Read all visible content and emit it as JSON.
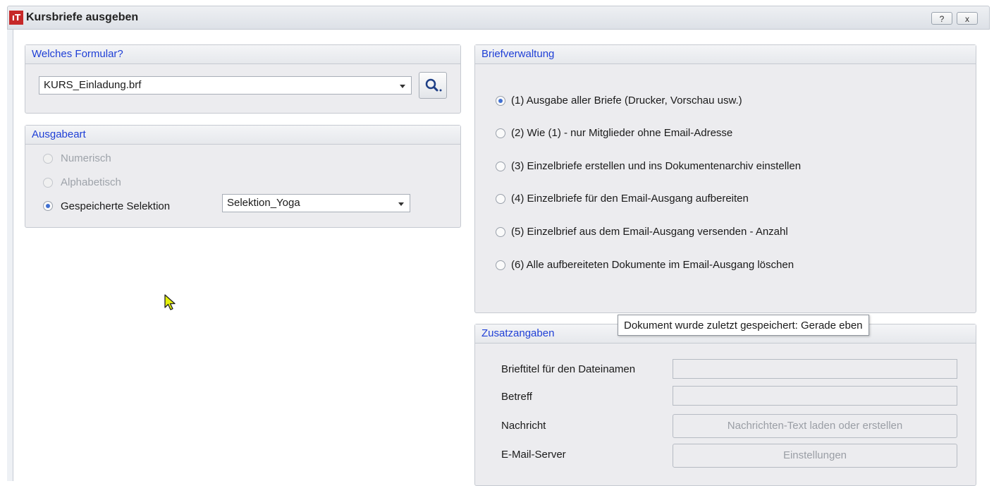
{
  "window": {
    "title": "Kursbriefe ausgeben",
    "help_button": "?",
    "close_button": "x"
  },
  "formular": {
    "header": "Welches Formular?",
    "selected": "KURS_Einladung.brf"
  },
  "ausgabeart": {
    "header": "Ausgabeart",
    "options": [
      {
        "label": "Numerisch",
        "checked": false,
        "enabled": false
      },
      {
        "label": "Alphabetisch",
        "checked": false,
        "enabled": false
      },
      {
        "label": "Gespeicherte Selektion",
        "checked": true,
        "enabled": true
      }
    ],
    "selection_value": "Selektion_Yoga"
  },
  "briefverwaltung": {
    "header": "Briefverwaltung",
    "options": [
      {
        "label": "(1) Ausgabe aller Briefe (Drucker, Vorschau usw.)",
        "checked": true
      },
      {
        "label": "(2) Wie (1) - nur Mitglieder ohne Email-Adresse",
        "checked": false
      },
      {
        "label": "(3) Einzelbriefe erstellen und ins Dokumentenarchiv einstellen",
        "checked": false
      },
      {
        "label": "(4) Einzelbriefe für den Email-Ausgang aufbereiten",
        "checked": false
      },
      {
        "label": "(5) Einzelbrief aus dem Email-Ausgang versenden - Anzahl",
        "checked": false
      },
      {
        "label": "(6) Alle aufbereiteten Dokumente im Email-Ausgang löschen",
        "checked": false
      }
    ]
  },
  "zusatzangaben": {
    "header": "Zusatzangaben",
    "brieftitel_label": "Brieftitel für den Dateinamen",
    "brieftitel_value": "",
    "betreff_label": "Betreff",
    "betreff_value": "",
    "nachricht_label": "Nachricht",
    "nachricht_button": "Nachrichten-Text laden oder erstellen",
    "server_label": "E-Mail-Server",
    "server_button": "Einstellungen"
  },
  "tooltip": "Dokument wurde zuletzt gespeichert: Gerade eben",
  "colors": {
    "header_text": "#1f3fd6",
    "radio_checked": "#3f6fd1",
    "app_icon": "#c62828",
    "cursor": "#e6f20a"
  }
}
